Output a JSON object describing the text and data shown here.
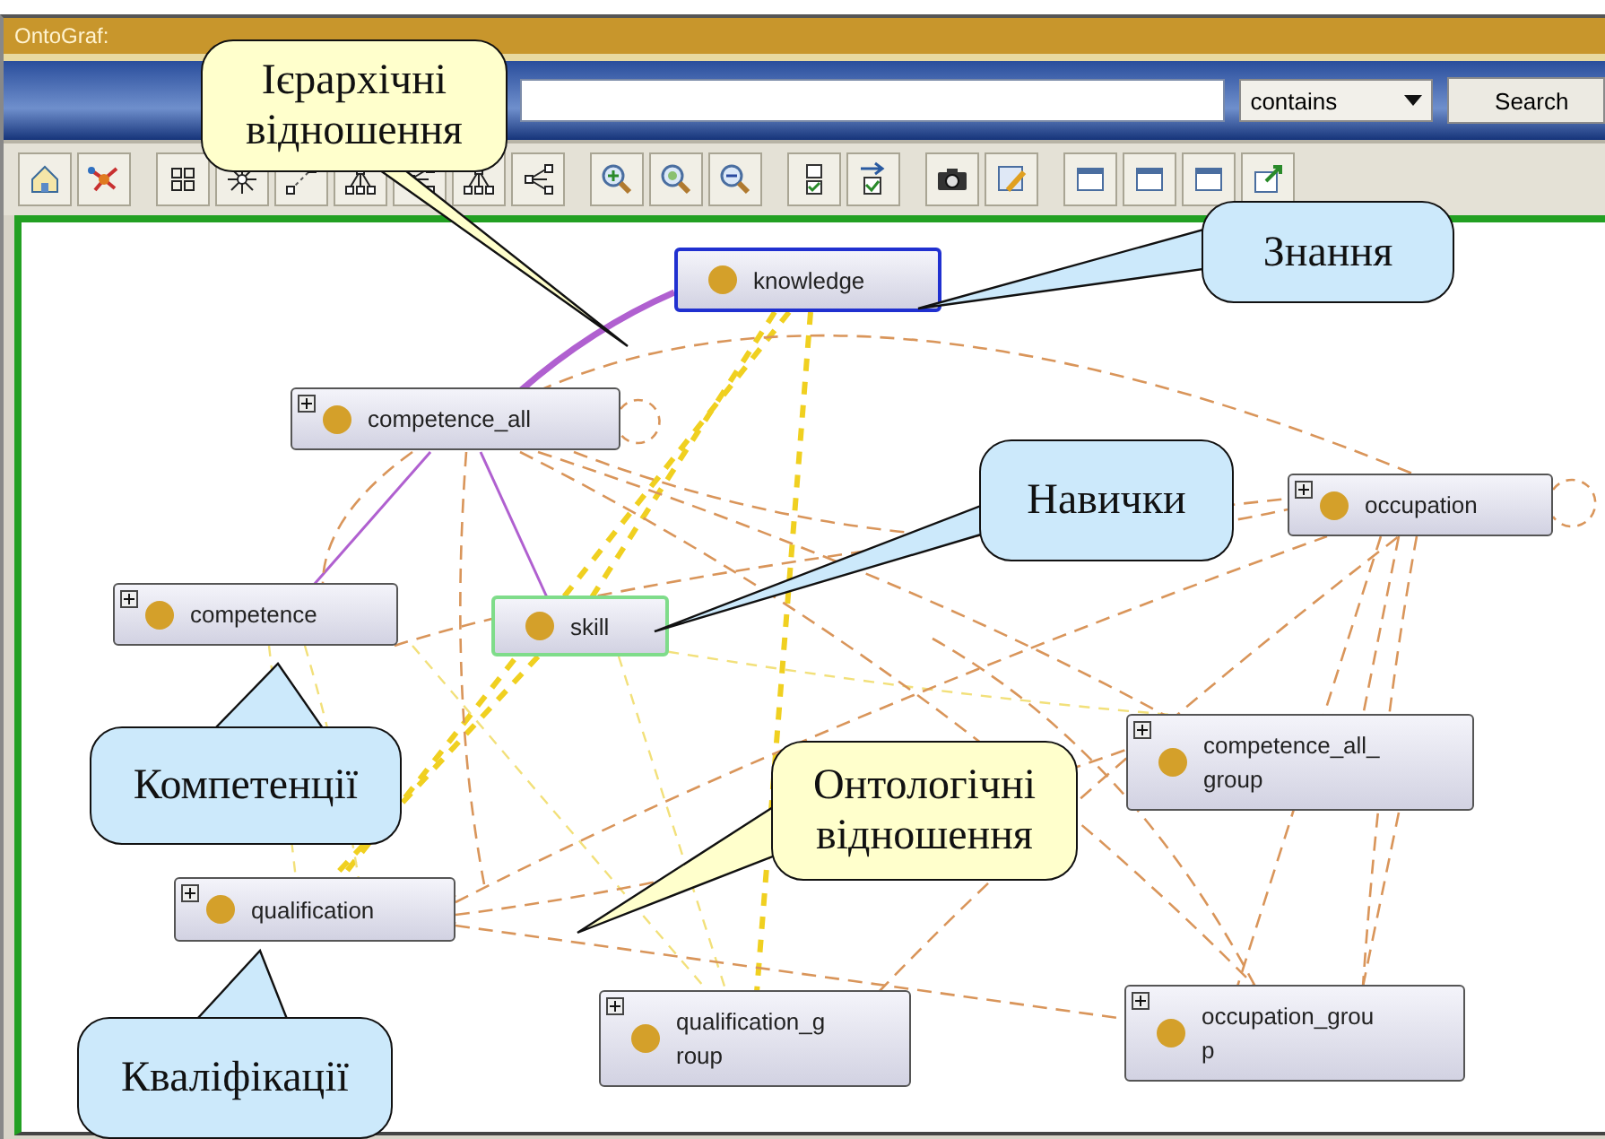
{
  "window": {
    "title": "OntoGraf:"
  },
  "search": {
    "match_mode": "contains",
    "button": "Search"
  },
  "nodes": [
    {
      "label": "knowledge",
      "selected": true,
      "hovered": false,
      "expandable": false
    },
    {
      "label": "competence_all",
      "selected": false,
      "hovered": false,
      "expandable": true
    },
    {
      "label": "competence",
      "selected": false,
      "hovered": false,
      "expandable": true
    },
    {
      "label": "skill",
      "selected": false,
      "hovered": true,
      "expandable": false
    },
    {
      "label": "occupation",
      "selected": false,
      "hovered": false,
      "expandable": true
    },
    {
      "label": "competence_all_\ngroup",
      "selected": false,
      "hovered": false,
      "expandable": true
    },
    {
      "label": "qualification",
      "selected": false,
      "hovered": false,
      "expandable": true
    },
    {
      "label": "qualification_g\nroup",
      "selected": false,
      "hovered": false,
      "expandable": true
    },
    {
      "label": "occupation_grou\np",
      "selected": false,
      "hovered": false,
      "expandable": true
    }
  ],
  "callouts": [
    {
      "text": "Ієрархічні відношення",
      "color": "#ffffcc"
    },
    {
      "text": "Знання",
      "color": "#cce9fb"
    },
    {
      "text": "Навички",
      "color": "#cce9fb"
    },
    {
      "text": "Компетенції",
      "color": "#cce9fb"
    },
    {
      "text": "Онтологічні відношення",
      "color": "#ffffcc"
    },
    {
      "text": "Кваліфікації",
      "color": "#cce9fb"
    }
  ]
}
